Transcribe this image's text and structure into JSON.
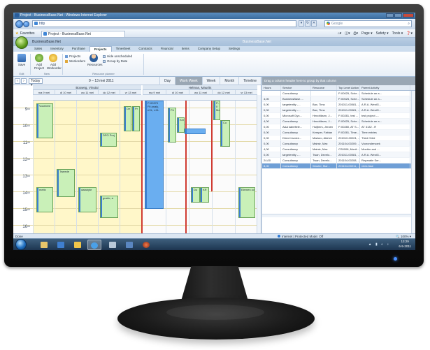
{
  "browser": {
    "title": "Project - BusinessBase.Net - Windows Internet Explorer",
    "address": "http",
    "search_placeholder": "Google",
    "favorites_label": "Favorites",
    "tab_title": "Project - BusinessBase.Net",
    "commands": [
      "Page ▾",
      "Safety ▾",
      "Tools ▾",
      "❓▾"
    ],
    "status_done": "Done",
    "zone": "Internet | Protected Mode: Off",
    "zoom": "100%"
  },
  "app": {
    "name": "BusinessBase.Net",
    "title_right": "BusinessBase.Net",
    "tabs": [
      "Sales",
      "Inventory",
      "Purchase",
      "Projects",
      "Timesheet",
      "Contracts",
      "Financial",
      "Items",
      "Company Setup",
      "Settings"
    ],
    "active_tab": "Projects",
    "ribbon": {
      "save": "Save",
      "add_project": "Add Project",
      "add_workorder": "Add Workorder",
      "projects": "Projects",
      "workorders": "Workorders",
      "resources": "Resources",
      "hide_unscheduled": "Hide unscheduled",
      "group_by_date": "Group by Date",
      "group_edit": "Edit",
      "group_new": "New",
      "group_planner": "Resource planner"
    }
  },
  "scheduler": {
    "today": "Today",
    "date_range": "9 – 13 mei 2011",
    "views": [
      "Day",
      "Work Week",
      "Week",
      "Month",
      "Timeline"
    ],
    "active_view": "Work Week",
    "resources": [
      "Boxweg, Vinutai",
      "Helman, Maurits"
    ],
    "days": [
      "ma 9 mei",
      "di 10 mei",
      "wo 11 mei",
      "do 12 mei",
      "vr 13 mei"
    ],
    "hours": [
      {
        "h": "9",
        "m": "00"
      },
      {
        "h": "10",
        "m": "00"
      },
      {
        "h": "11",
        "m": "00"
      },
      {
        "h": "12",
        "m": "00"
      },
      {
        "h": "13",
        "m": "00"
      },
      {
        "h": "14",
        "m": "00"
      },
      {
        "h": "15",
        "m": "00"
      },
      {
        "h": "16",
        "m": "00"
      },
      {
        "h": "17",
        "m": "00"
      }
    ],
    "appointments": {
      "a1": "Voorbere",
      "a2": "Tweede",
      "a3": "mettv",
      "a4": "databyte",
      "a5": "DPO Proj",
      "a6": "gustic, a",
      "a7": "De",
      "a8": "Pr",
      "b1": "P-00370",
      "b1b": "Fit analy, eXL, eXL",
      "b2": "Pri",
      "b3": "Kel",
      "b4": "P-0",
      "b4b": "Ma",
      "b5": "Co",
      "b6": "Do",
      "b7": "KR",
      "b8": "Elemen ov"
    }
  },
  "grid": {
    "group_hint": "Drag a column header here to group by that column",
    "columns": [
      "Hours",
      "Service",
      "Resource",
      "Top Level Action",
      "Parent Activity"
    ],
    "rows": [
      [
        "",
        "Consultancy",
        "",
        "P-00025, Sche...",
        "Schedule an a..."
      ],
      [
        "4,00",
        "BusinessBase....",
        "",
        "P-00025, Sche...",
        "Schedule an a..."
      ],
      [
        "0,00",
        "targetentity -...",
        "Bax, Timo",
        "201011-00081, ...",
        "A.R.A. WestG..."
      ],
      [
        "0,00",
        "targetentity -...",
        "Bax, Timo",
        "201011-00081, ...",
        "A.R.A. WestG..."
      ],
      [
        "0,00",
        "Microsoft Dyn...",
        "Hendriksen, J...",
        "P-00281, test ...",
        "test project -..."
      ],
      [
        "4,00",
        "Consultancy",
        "Hendriksen, J...",
        "P-00025, Sche...",
        "Schedule an a..."
      ],
      [
        "0,00",
        "AAA kabeltele...",
        "Huijbers, Jeroen",
        "P-00280, AT S...",
        "AT 3132 - R"
      ],
      [
        "0,00",
        "Consultancy",
        "Kemper, Fabian",
        "P-00281, Time...",
        "Time entries"
      ],
      [
        "0,00",
        "Direct invoice...",
        "Maduro, Aldrich",
        "201010-00001, ...",
        "Third Child"
      ],
      [
        "0,00",
        "Consultancy",
        "Maintz, Max",
        "201104-00209, ...",
        "Voorondersoek"
      ],
      [
        "4,00",
        "Consultancy",
        "Maintz, Max",
        "CS0008, Monit...",
        "Monitor and ..."
      ],
      [
        "0,00",
        "targetentity -...",
        "Twan, Develo...",
        "201011-00081, ...",
        "A.R.A. WestG..."
      ],
      [
        "24,00",
        "Consultancy",
        "Twan, Develo...",
        "201104-00208, ...",
        "Reparatie Ser..."
      ],
      [
        "8,00",
        "Consultancy",
        "Wouter, Mar...",
        "201104-00211, ...",
        "vries fase"
      ]
    ],
    "selected_row": 13,
    "pager": "Page 1 of 1"
  },
  "taskbar": {
    "time": "13:29",
    "date": "6-5-2011"
  }
}
